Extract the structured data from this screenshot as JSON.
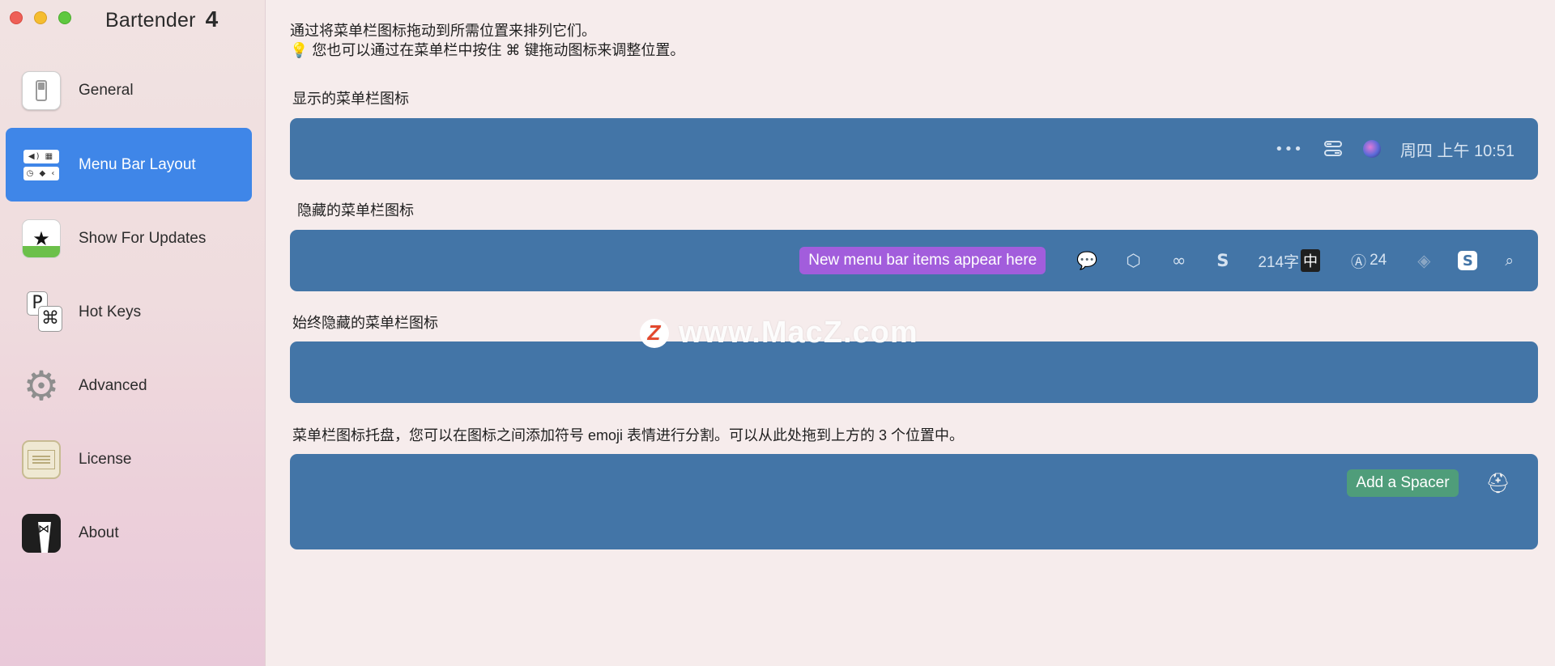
{
  "window": {
    "app_name": "Bartender",
    "app_version": "4"
  },
  "sidebar": {
    "items": [
      {
        "id": "general",
        "label": "General",
        "icon": "general-switch-icon"
      },
      {
        "id": "menu-bar-layout",
        "label": "Menu Bar Layout",
        "icon": "menu-bar-layout-icon",
        "active": true
      },
      {
        "id": "show-for-updates",
        "label": "Show For Updates",
        "icon": "star-icon"
      },
      {
        "id": "hot-keys",
        "label": "Hot Keys",
        "icon": "command-key-icon"
      },
      {
        "id": "advanced",
        "label": "Advanced",
        "icon": "gear-icon"
      },
      {
        "id": "license",
        "label": "License",
        "icon": "certificate-icon"
      },
      {
        "id": "about",
        "label": "About",
        "icon": "tuxedo-icon"
      }
    ]
  },
  "main": {
    "intro_line1": "通过将菜单栏图标拖动到所需位置来排列它们。",
    "intro_line2": "💡 您也可以通过在菜单栏中按住 ⌘ 键拖动图标来调整位置。",
    "shown": {
      "label": "显示的菜单栏图标",
      "items": [
        "more-dots-icon",
        "control-center-icon",
        "siri-icon"
      ],
      "more_glyph": "•••",
      "clock": "周四 上午 10:51"
    },
    "hidden": {
      "label": "隐藏的菜单栏图标",
      "new_items_label": "New menu bar items appear here",
      "word_count": "214字",
      "ime_badge": "中",
      "update_count": "24",
      "icons": [
        "chat-bubble-icon",
        "cube-icon",
        "creative-cloud-icon",
        "s-logo-icon",
        "input-method-icon",
        "app-store-icon",
        "wifi-icon",
        "s-box-icon",
        "search-icon"
      ]
    },
    "always_hidden": {
      "label": "始终隐藏的菜单栏图标"
    },
    "tray": {
      "label": "菜单栏图标托盘，您可以在图标之间添加符号 emoji 表情进行分割。可以从此处拖到上方的 3 个位置中。",
      "add_spacer_label": "Add a Spacer",
      "icons": [
        "bartender-hat-icon"
      ]
    },
    "watermark": "www.MacZ.com"
  },
  "colors": {
    "accent": "#3f86e8",
    "panel": "#4375a7",
    "new_items_pill": "#a25ddc",
    "spacer_button": "#4f9d7a"
  }
}
